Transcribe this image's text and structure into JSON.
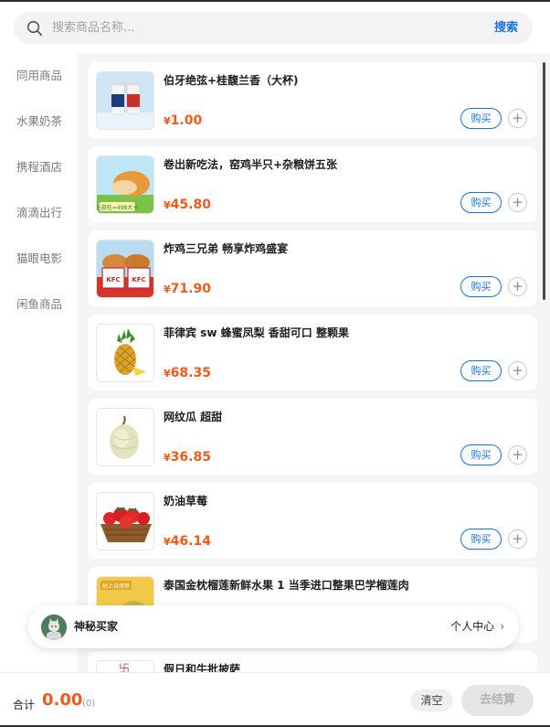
{
  "search": {
    "placeholder": "搜索商品名称...",
    "button_label": "搜索"
  },
  "sidebar": {
    "items": [
      {
        "label": "同用商品"
      },
      {
        "label": "水果奶茶"
      },
      {
        "label": "携程酒店"
      },
      {
        "label": "滴滴出行"
      },
      {
        "label": "猫眼电影"
      },
      {
        "label": "闲鱼商品"
      }
    ]
  },
  "products": [
    {
      "title": "伯牙绝弦+桂馥兰香（大杯)",
      "currency": "¥",
      "price": "1.00"
    },
    {
      "title": "卷出新吃法，窑鸡半只+杂粮饼五张",
      "currency": "¥",
      "price": "45.80"
    },
    {
      "title": "炸鸡三兄弟 畅享炸鸡盛宴",
      "currency": "¥",
      "price": "71.90"
    },
    {
      "title": "菲律宾 sw 蜂蜜凤梨 香甜可口 整颗果",
      "currency": "¥",
      "price": "68.35"
    },
    {
      "title": "网纹瓜 超甜",
      "currency": "¥",
      "price": "36.85"
    },
    {
      "title": "奶油草莓",
      "currency": "¥",
      "price": "46.14"
    },
    {
      "title": "泰国金枕榴莲新鲜水果 1 当季进口整果巴学榴莲肉",
      "currency": "¥",
      "price": ""
    },
    {
      "title": "假日和牛批披萨",
      "currency": "¥",
      "price": ""
    }
  ],
  "product_labels": {
    "buy": "购买",
    "add": "+"
  },
  "thumb_texts": {
    "kfc_bucket": "KFC",
    "promo_2": "吃皮吃=498大卡",
    "promo_7": "树上自然熟"
  },
  "user": {
    "name": "神秘买家",
    "center_label": "个人中心",
    "chevron": "›"
  },
  "footer": {
    "total_label": "合计",
    "total_value": "0.00",
    "count": "(0)",
    "clear_label": "清空",
    "checkout_label": "去结算"
  },
  "colors": {
    "accent_blue": "#1a73d9",
    "price_orange": "#f05a1a",
    "background": "#f4f5f7"
  }
}
